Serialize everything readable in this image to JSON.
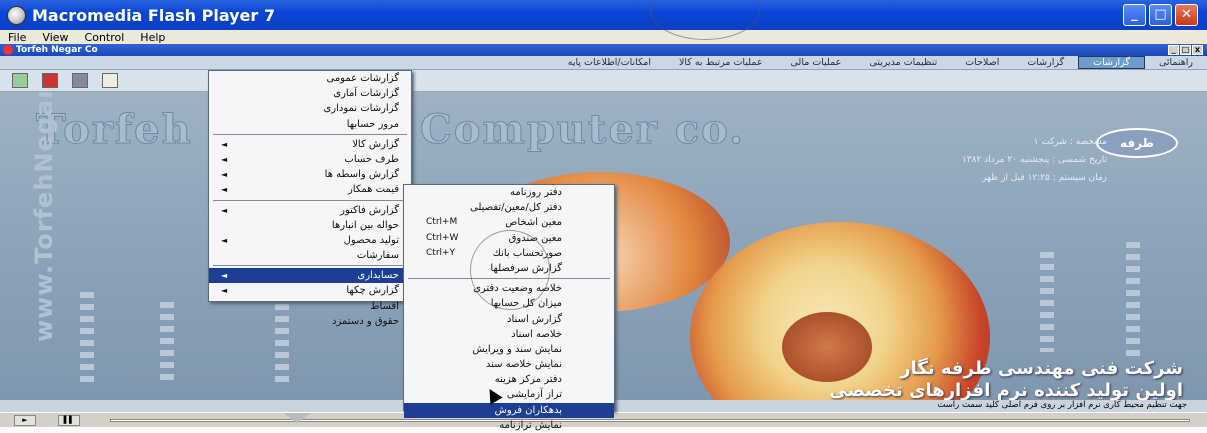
{
  "window": {
    "title": "Macromedia Flash Player 7",
    "min": "_",
    "max": "□",
    "close": "✕"
  },
  "menubar": [
    "File",
    "View",
    "Control",
    "Help"
  ],
  "inner": {
    "title": "Torfeh Negar Co"
  },
  "appmenu": [
    "راهنمائى",
    "گزارشات",
    "گزارشات",
    "اصلاحات",
    "تنظيمات مديريتى",
    "عمليات مالى",
    "عمليات مرتبط به كالا",
    "امكانات/اطلاعات پايه"
  ],
  "bg": {
    "company_left": "Torfeh",
    "company_right": "Computer co.",
    "vertical": "www.TorfehNegar.com",
    "logo": "طرفه",
    "info": [
      "مشخصه : شركت ۱",
      "تاريخ شمسى : پنجشنبه ۲۰ مرداد ۱۳۸۲",
      "زمان سيستم : ۱۲:۲۵ قبل از ظهر"
    ],
    "slogan1": "شركت فنى مهندسى طرفه نگار",
    "slogan2": "اولين توليد كننده نرم افزارهاى تخصصى",
    "hint": "جهت تنظيم محيط كارى نرم افزار بر روى فرم اصلى كليد سمت راست"
  },
  "menu1": [
    {
      "label": "گزارشات عمومى"
    },
    {
      "label": "گزارشات آمارى"
    },
    {
      "label": "گزارشات نمودارى"
    },
    {
      "label": "مرور حسابها"
    },
    {
      "sep": true
    },
    {
      "label": "گزارش كالا",
      "arrow": "◄"
    },
    {
      "label": "طرف حساب",
      "arrow": "◄"
    },
    {
      "label": "گزارش واسطه ها",
      "arrow": "◄"
    },
    {
      "label": "قيمت همكار",
      "arrow": "◄"
    },
    {
      "sep": true
    },
    {
      "label": "گزارش فاكتور",
      "arrow": "◄"
    },
    {
      "label": "حواله بين انبارها"
    },
    {
      "label": "توليد محصول",
      "arrow": "◄"
    },
    {
      "label": "سفارشات"
    },
    {
      "sep": true
    },
    {
      "label": "حسابدارى",
      "arrow": "◄",
      "sel": true
    },
    {
      "label": "گزارش چكها",
      "arrow": "◄"
    },
    {
      "label": "اقساط"
    },
    {
      "label": "حقوق و دستمزد"
    }
  ],
  "menu2": [
    {
      "label": "دفتر روزنامه"
    },
    {
      "label": "دفتر كل/معين/تفصيلى"
    },
    {
      "label": "معين اشخاص",
      "sc": "Ctrl+M"
    },
    {
      "label": "معين صندوق",
      "sc": "Ctrl+W"
    },
    {
      "label": "صورتحساب بانك",
      "sc": "Ctrl+Y"
    },
    {
      "label": "گزارش سرفصلها"
    },
    {
      "sep": true
    },
    {
      "label": "خلاصه وضعيت دفترى"
    },
    {
      "label": "ميزان كل حسابها"
    },
    {
      "label": "گزارش اسناد"
    },
    {
      "label": "خلاصه اسناد"
    },
    {
      "label": "نمايش سند و ويرايش"
    },
    {
      "label": "نمايش خلاصه سند"
    },
    {
      "label": "دفتر مركز هزينه"
    },
    {
      "label": "تراز آزمايشى"
    },
    {
      "label": "بدهكاران فروش",
      "sel": true
    },
    {
      "label": "نمايش ترازنامه"
    }
  ],
  "player": {
    "play": "►",
    "pause": "▌▌"
  }
}
